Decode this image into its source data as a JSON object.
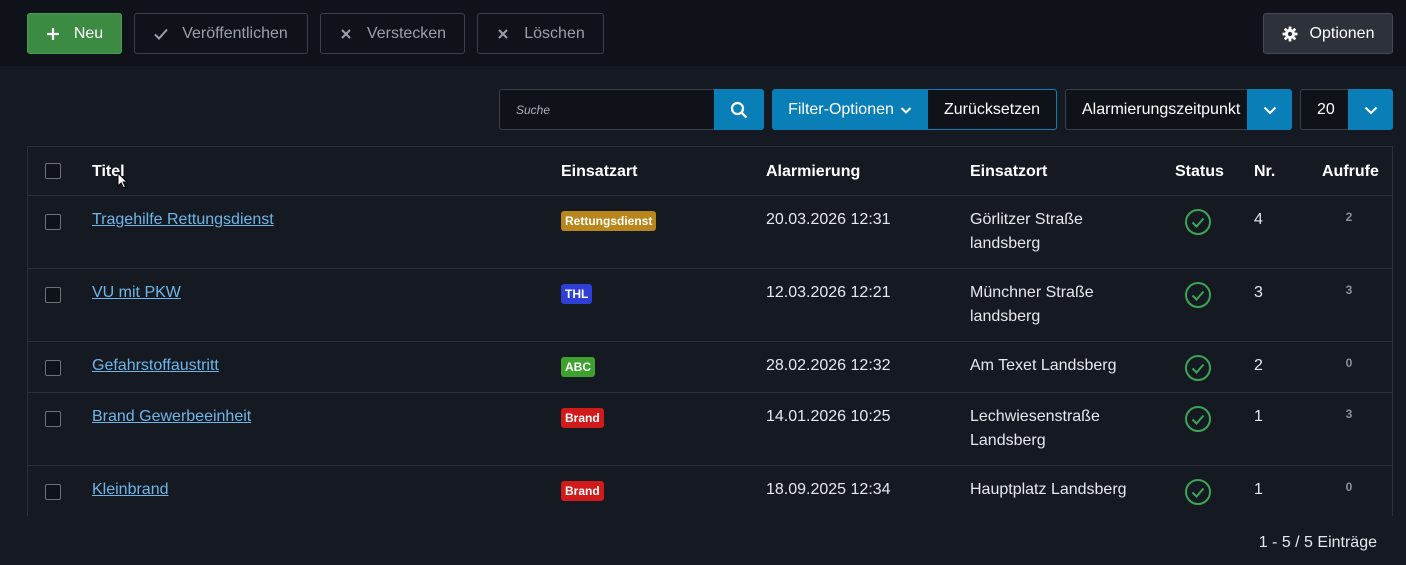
{
  "toolbar": {
    "new_label": "Neu",
    "publish_label": "Veröffentlichen",
    "hide_label": "Verstecken",
    "delete_label": "Löschen",
    "options_label": "Optionen"
  },
  "filters": {
    "search_placeholder": "Suche",
    "filter_options_label": "Filter-Optionen",
    "reset_label": "Zurücksetzen",
    "sort_value": "Alarmierungszeitpunkt",
    "limit_value": "20"
  },
  "table": {
    "headers": {
      "title": "Titel",
      "type": "Einsatzart",
      "alarm": "Alarmierung",
      "location": "Einsatzort",
      "status": "Status",
      "nr": "Nr.",
      "hits": "Aufrufe"
    },
    "rows": [
      {
        "title": "Tragehilfe Rettungsdienst",
        "type": "Rettungsdienst",
        "type_color": "#b8861b",
        "alarm": "20.03.2026 12:31",
        "location_line1": "Görlitzer Straße",
        "location_line2": "landsberg",
        "nr": "4",
        "hits": "2"
      },
      {
        "title": "VU mit PKW",
        "type": "THL",
        "type_color": "#2f3fd6",
        "alarm": "12.03.2026 12:21",
        "location_line1": "Münchner Straße",
        "location_line2": "landsberg",
        "nr": "3",
        "hits": "3"
      },
      {
        "title": "Gefahrstoffaustritt",
        "type": "ABC",
        "type_color": "#3ea02f",
        "alarm": "28.02.2026 12:32",
        "location_line1": "Am Texet Landsberg",
        "location_line2": "",
        "nr": "2",
        "hits": "0"
      },
      {
        "title": "Brand Gewerbeeinheit",
        "type": "Brand",
        "type_color": "#d11a1a",
        "alarm": "14.01.2026 10:25",
        "location_line1": "Lechwiesenstraße",
        "location_line2": "Landsberg",
        "nr": "1",
        "hits": "3"
      },
      {
        "title": "Kleinbrand",
        "type": "Brand",
        "type_color": "#d11a1a",
        "alarm": "18.09.2025 12:34",
        "location_line1": "Hauptplatz Landsberg",
        "location_line2": "",
        "nr": "1",
        "hits": "0"
      }
    ]
  },
  "footer": {
    "pagination_info": "1 - 5 / 5 Einträge"
  },
  "colors": {
    "accent": "#0a7fb7",
    "success": "#3c8b43",
    "status_published": "#3aa655"
  }
}
